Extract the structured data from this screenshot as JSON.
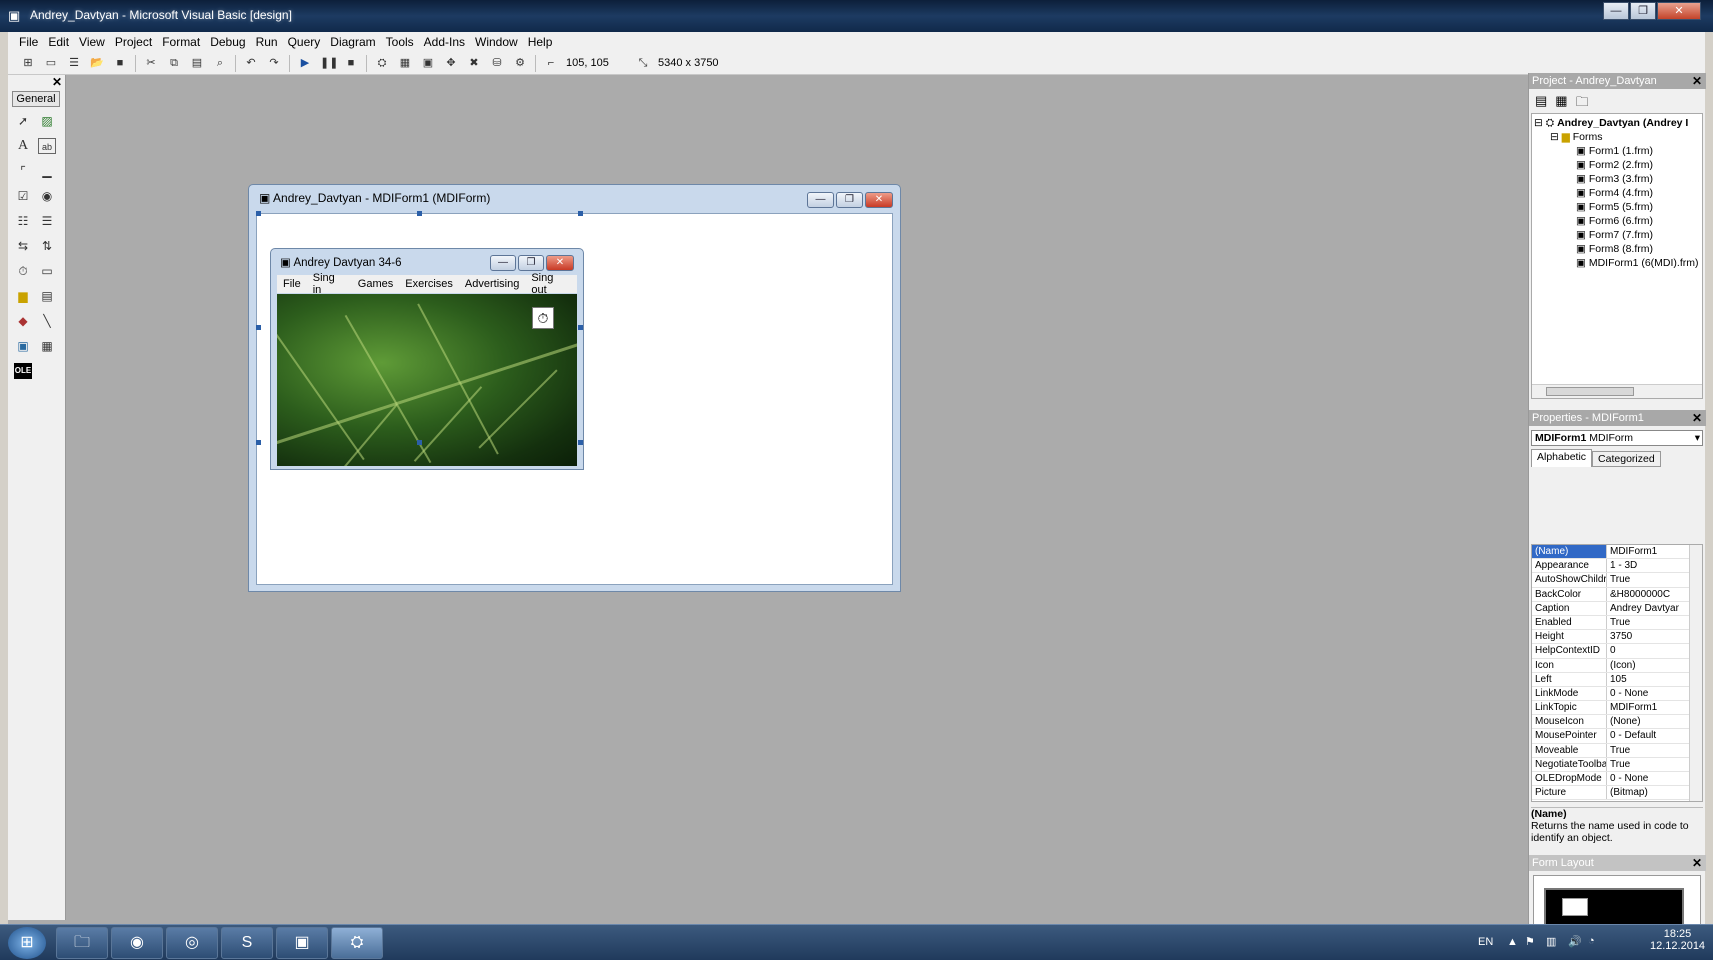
{
  "window": {
    "title": "Andrey_Davtyan - Microsoft Visual Basic [design]",
    "min": "—",
    "max": "❐",
    "close": "✕"
  },
  "menu": [
    "File",
    "Edit",
    "View",
    "Project",
    "Format",
    "Debug",
    "Run",
    "Query",
    "Diagram",
    "Tools",
    "Add-Ins",
    "Window",
    "Help"
  ],
  "toolbar": {
    "position": "105, 105",
    "size": "5340 x 3750"
  },
  "toolbox": {
    "title": "General",
    "close": "✕"
  },
  "mdi_form": {
    "title": "Andrey_Davtyan - MDIForm1 (MDIForm)"
  },
  "child_form": {
    "title": "Andrey Davtyan 34-6",
    "menu": [
      "File",
      "Sing in",
      "Games",
      "Exercises",
      "Advertising",
      "Sing out"
    ]
  },
  "project": {
    "title": "Project - Andrey_Davtyan",
    "root": "Andrey_Davtyan (Andrey I",
    "folder": "Forms",
    "items": [
      "Form1 (1.frm)",
      "Form2 (2.frm)",
      "Form3 (3.frm)",
      "Form4 (4.frm)",
      "Form5 (5.frm)",
      "Form6 (6.frm)",
      "Form7 (7.frm)",
      "Form8 (8.frm)",
      "MDIForm1 (6(MDI).frm)"
    ]
  },
  "properties": {
    "title": "Properties - MDIForm1",
    "object_name": "MDIForm1",
    "object_type": "MDIForm",
    "tabs": [
      "Alphabetic",
      "Categorized"
    ],
    "rows": [
      {
        "name": "(Name)",
        "value": "MDIForm1"
      },
      {
        "name": "Appearance",
        "value": "1 - 3D"
      },
      {
        "name": "AutoShowChildre",
        "value": "True"
      },
      {
        "name": "BackColor",
        "value": "&H8000000C"
      },
      {
        "name": "Caption",
        "value": "Andrey Davtyan"
      },
      {
        "name": "Enabled",
        "value": "True"
      },
      {
        "name": "Height",
        "value": "3750"
      },
      {
        "name": "HelpContextID",
        "value": "0"
      },
      {
        "name": "Icon",
        "value": "(Icon)"
      },
      {
        "name": "Left",
        "value": "105"
      },
      {
        "name": "LinkMode",
        "value": "0 - None"
      },
      {
        "name": "LinkTopic",
        "value": "MDIForm1"
      },
      {
        "name": "MouseIcon",
        "value": "(None)"
      },
      {
        "name": "MousePointer",
        "value": "0 - Default"
      },
      {
        "name": "Moveable",
        "value": "True"
      },
      {
        "name": "NegotiateToolbar",
        "value": "True"
      },
      {
        "name": "OLEDropMode",
        "value": "0 - None"
      },
      {
        "name": "Picture",
        "value": "(Bitmap)"
      }
    ],
    "desc_title": "(Name)",
    "desc_text": "Returns the name used in code to identify an object."
  },
  "form_layout": {
    "title": "Form Layout"
  },
  "tray": {
    "lang": "EN",
    "time": "18:25",
    "date": "12.12.2014"
  },
  "colors": {
    "selection": "#3169c6",
    "accent": "#2b5fa8"
  }
}
